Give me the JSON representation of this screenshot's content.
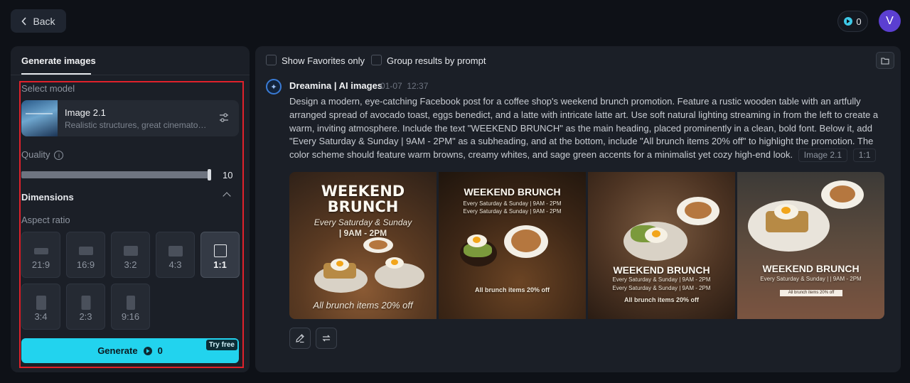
{
  "header": {
    "back_label": "Back",
    "credits": "0",
    "avatar_initial": "V"
  },
  "left_panel": {
    "tab_label": "Generate images",
    "select_model_label": "Select model",
    "model": {
      "name": "Image 2.1",
      "description": "Realistic structures, great cinematography"
    },
    "quality_label": "Quality",
    "quality_value": "10",
    "quality_level": 1.0,
    "dimensions_label": "Dimensions",
    "aspect_ratio_label": "Aspect ratio",
    "aspect_ratios": [
      {
        "label": "21:9",
        "active": false
      },
      {
        "label": "16:9",
        "active": false
      },
      {
        "label": "3:2",
        "active": false
      },
      {
        "label": "4:3",
        "active": false
      },
      {
        "label": "1:1",
        "active": true
      },
      {
        "label": "3:4",
        "active": false
      },
      {
        "label": "2:3",
        "active": false
      },
      {
        "label": "9:16",
        "active": false
      }
    ],
    "generate_label": "Generate",
    "generate_cost": "0",
    "try_free_label": "Try free"
  },
  "right_panel": {
    "show_favorites_label": "Show Favorites only",
    "group_results_label": "Group results by prompt",
    "brand_name": "Dreamina | AI images",
    "date": "01-07",
    "time": "12:37",
    "prompt": "Design a modern, eye-catching Facebook post for a coffee shop's weekend brunch promotion. Feature a rustic wooden table with an artfully arranged spread of avocado toast, eggs benedict, and a latte with intricate latte art. Use soft natural lighting streaming in from the left to create a warm, inviting atmosphere. Include the text \"WEEKEND BRUNCH\" as the main heading, placed prominently in a clean, bold font. Below it, add \"Every Saturday & Sunday | 9AM - 2PM\" as a subheading, and at the bottom, include \"All brunch items 20% off\" to highlight the promotion. The color scheme should feature warm browns, creamy whites, and sage green accents for a minimalist yet cozy high-end look.",
    "tags": [
      "Image 2.1",
      "1:1"
    ],
    "images": [
      {
        "title": "WEEKEND BRUNCH",
        "subtitle": "Every Saturday & Sunday",
        "hours": "| 9AM - 2PM",
        "offer": "All brunch items 20% off"
      },
      {
        "title": "WEEKEND BRUNCH",
        "subtitle": "Every Saturday & Sunday | 9AM - 2PM",
        "hours": "Every Saturday & Sunday | 9AM - 2PM",
        "offer": "All brunch items 20% off"
      },
      {
        "title": "WEEKEND BRUNCH",
        "subtitle": "Every Saturday & Sunday | 9AM - 2PM",
        "hours": "Every Saturday & Sunday | 9AM - 2PM",
        "offer": "All brunch items 20% off"
      },
      {
        "title": "WEEKEND BRUNCH",
        "subtitle": "Every Saturday & Sunday | | 9AM - 2PM",
        "offer": "All brunch items 20% off"
      }
    ]
  },
  "colors": {
    "accent": "#22d3ee",
    "highlight_border": "#e0212b",
    "avatar_bg": "#5b3fd1"
  }
}
